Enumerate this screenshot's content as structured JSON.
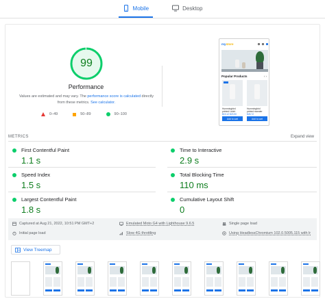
{
  "tabs": [
    {
      "label": "Mobile",
      "active": true,
      "icon": "mobile-icon"
    },
    {
      "label": "Desktop",
      "active": false,
      "icon": "desktop-icon"
    }
  ],
  "performance": {
    "score": "99",
    "score_fraction": 0.99,
    "title": "Performance",
    "note_prefix": "Values are estimated and may vary. The ",
    "note_link1": "performance score is calculated",
    "note_middle": " directly from these metrics. ",
    "note_link2": "See calculator.",
    "color": "#0cce6b"
  },
  "legend": [
    {
      "label": "0–49",
      "color": "#e53935",
      "shape": "triangle"
    },
    {
      "label": "50–89",
      "color": "#ffa400",
      "shape": "square"
    },
    {
      "label": "90–100",
      "color": "#0cce6b",
      "shape": "circle"
    }
  ],
  "screenshot": {
    "logo_main": "my",
    "logo_accent": "store",
    "section": "Popular Products",
    "products": [
      {
        "name": "Hummingbird printed t-shirt",
        "price": "$19.12 $23.90",
        "button": "Add to cart"
      },
      {
        "name": "Hummingbird printed sweater",
        "price": "$28.72",
        "button": "Add to cart"
      }
    ]
  },
  "metrics": {
    "label": "METRICS",
    "expand": "Expand view",
    "items": [
      {
        "name": "First Contentful Paint",
        "value": "1.1 s"
      },
      {
        "name": "Time to Interactive",
        "value": "2.9 s"
      },
      {
        "name": "Speed Index",
        "value": "1.5 s"
      },
      {
        "name": "Total Blocking Time",
        "value": "110 ms"
      },
      {
        "name": "Largest Contentful Paint",
        "value": "1.8 s"
      },
      {
        "name": "Cumulative Layout Shift",
        "value": "0"
      }
    ]
  },
  "runtime": {
    "captured": "Captured at Aug 21, 2022, 10:51 PM GMT+2",
    "device": "Emulated Moto G4 with Lighthouse 9.6.5",
    "load": "Single page load",
    "initial": "Initial page load",
    "throttle": "Slow 4G throttling",
    "browser": "Using HeadlessChromium 102.0.5005.115 with lr"
  },
  "treemap": {
    "label": "View Treemap"
  },
  "filmstrip": {
    "frames": 10
  }
}
